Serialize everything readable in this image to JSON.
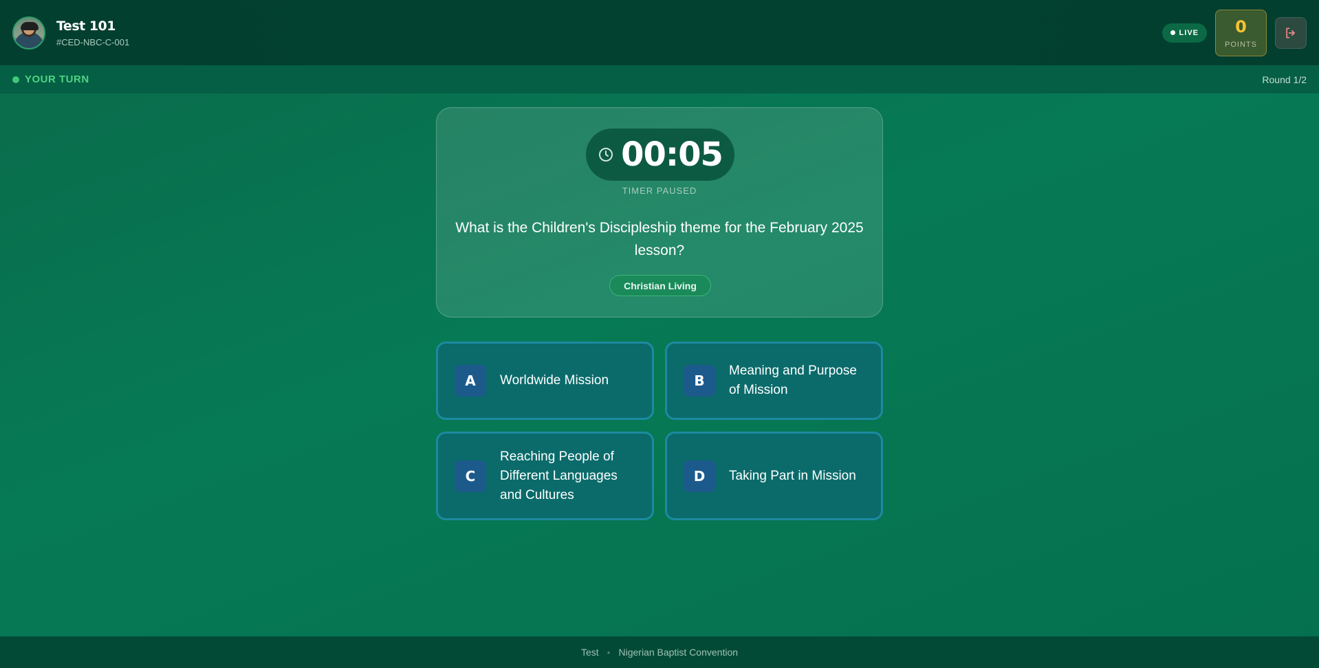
{
  "header": {
    "player_name": "Test 101",
    "player_code": "#CED-NBC-C-001",
    "live_label": "LIVE",
    "points_value": "0",
    "points_label": "POINTS"
  },
  "status": {
    "turn_label": "YOUR TURN",
    "round_label": "Round 1/2"
  },
  "question": {
    "timer": "00:05",
    "timer_state": "TIMER PAUSED",
    "text": "What is the Children's Discipleship theme for the February 2025 lesson?",
    "category": "Christian Living"
  },
  "options": [
    {
      "letter": "A",
      "text": "Worldwide Mission"
    },
    {
      "letter": "B",
      "text": "Meaning and Purpose of Mission"
    },
    {
      "letter": "C",
      "text": "Reaching People of Different Languages and Cultures"
    },
    {
      "letter": "D",
      "text": "Taking Part in Mission"
    }
  ],
  "footer": {
    "left": "Test",
    "right": "Nigerian Baptist Convention"
  },
  "colors": {
    "accent_green": "#3fc878",
    "points_gold": "#f5c431",
    "option_border": "#1c8aa0",
    "letter_badge": "#1c5a8c"
  },
  "icons": {
    "timer": "clock-icon",
    "logout": "logout-icon",
    "live": "live-dot-icon"
  }
}
